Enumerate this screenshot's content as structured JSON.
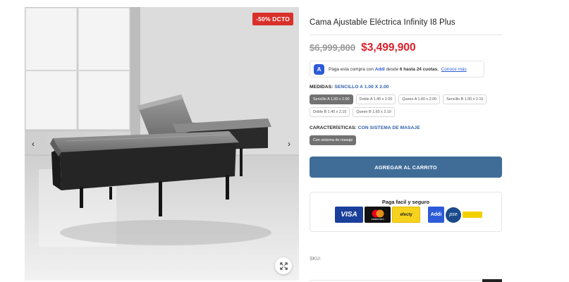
{
  "product": {
    "title": "Cama Ajustable Eléctrica Infinity I8 Plus",
    "discount_badge": "-50% DCTO",
    "price_old": "$6,999,800",
    "price_new": "$3,499,900"
  },
  "gallery": {
    "prev_icon": "chevron-left-icon",
    "next_icon": "chevron-right-icon",
    "zoom_icon": "expand-icon"
  },
  "addi": {
    "logo_letter": "A",
    "text_before": "Paga esta compra con",
    "brand": "Addi",
    "text_middle": "desde",
    "highlight": "6 hasta 24 cuotas.",
    "link": "Conoce más"
  },
  "measures": {
    "label": "MEDIDAS:",
    "selected": "SENCILLO A 1.00 X 2.00",
    "options": [
      {
        "label": "Sencillo A 1.00 x 2.00",
        "active": true
      },
      {
        "label": "Doble A 1.40 x 2.00",
        "active": false
      },
      {
        "label": "Queen A 1.60 x 2.00",
        "active": false
      },
      {
        "label": "Sencillo B 1.00 x 2.10",
        "active": false
      },
      {
        "label": "Doble B 1.40 x 2.10",
        "active": false
      },
      {
        "label": "Queen B 1.60 x 2.10",
        "active": false
      }
    ]
  },
  "features": {
    "label": "CARACTERÍSTICAS:",
    "selected": "CON SISTEMA DE MASAJE",
    "options": [
      {
        "label": "Con sistema de masaje",
        "active": true
      }
    ]
  },
  "cart": {
    "button_label": "AGREGAR AL CARRITO"
  },
  "payment": {
    "title": "Paga facil y seguro",
    "logos": {
      "visa": "VISA",
      "mastercard": "mastercard",
      "efecty": "efecty",
      "addi": "Addi",
      "pse": "pse"
    }
  },
  "sku": {
    "label": "SKU:"
  },
  "colors": {
    "badge": "#d9302a",
    "price_new": "#d8202a",
    "cart_button": "#3f6d98",
    "accent_blue": "#2c5ea8",
    "chip_active": "#727272"
  }
}
